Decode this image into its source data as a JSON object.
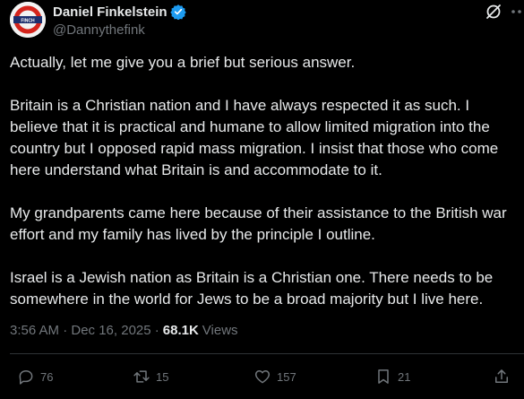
{
  "author": {
    "display_name": "Daniel Finkelstein",
    "handle": "@Dannythefink",
    "avatar_text": "FINCH"
  },
  "tweet": {
    "paragraphs": [
      "Actually, let me give you a brief but serious answer.",
      "Britain is a Christian nation and I have always respected it as such. I believe that it is practical and humane to allow limited migration into the country but I opposed rapid mass migration. I insist that those who come here understand what Britain is and accommodate to it.",
      "My grandparents came here because of their assistance to the British war effort and my family has lived by the principle I outline.",
      "Israel is a Jewish nation as Britain is a Christian one. There needs to be somewhere in the world for Jews to be a broad majority but I live here."
    ],
    "timestamp": "3:56 AM · Dec 16, 2025 ·",
    "views_count": "68.1K",
    "views_label": "Views"
  },
  "actions": {
    "replies": "76",
    "reposts": "15",
    "likes": "157",
    "bookmarks": "21"
  },
  "colors": {
    "background": "#000000",
    "text": "#e7e9ea",
    "secondary": "#71767b",
    "verified": "#1d9bf0",
    "divider": "#2f3336"
  },
  "icons": [
    "verified-badge-icon",
    "grok-icon",
    "more-icon",
    "reply-icon",
    "repost-icon",
    "like-icon",
    "bookmark-icon",
    "share-icon"
  ]
}
